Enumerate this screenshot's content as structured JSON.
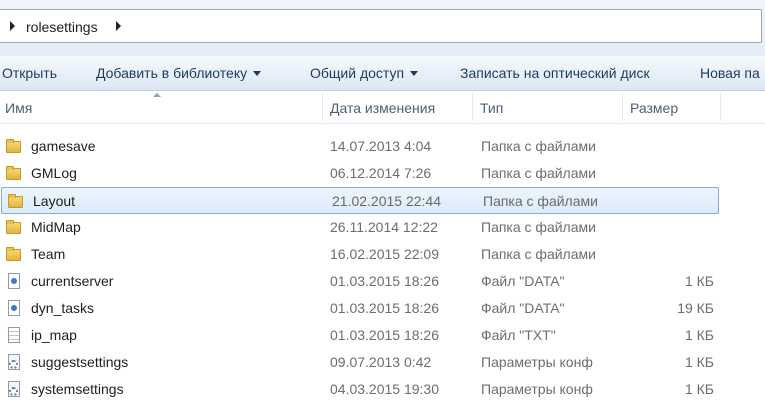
{
  "address": {
    "crumb": "rolesettings"
  },
  "toolbar": {
    "open": "Открыть",
    "add_to_library": "Добавить в библиотеку",
    "share": "Общий доступ",
    "burn": "Записать на оптический диск",
    "new_folder": "Новая па"
  },
  "columns": {
    "name": "Имя",
    "date": "Дата изменения",
    "type": "Тип",
    "size": "Размер"
  },
  "files": [
    {
      "name": "gamesave",
      "date": "14.07.2013 4:04",
      "type": "Папка с файлами",
      "size": "",
      "icon": "folder-icon",
      "selected": false
    },
    {
      "name": "GMLog",
      "date": "06.12.2014 7:26",
      "type": "Папка с файлами",
      "size": "",
      "icon": "folder-icon",
      "selected": false
    },
    {
      "name": "Layout",
      "date": "21.02.2015 22:44",
      "type": "Папка с файлами",
      "size": "",
      "icon": "folder-icon",
      "selected": true
    },
    {
      "name": "MidMap",
      "date": "26.11.2014 12:22",
      "type": "Папка с файлами",
      "size": "",
      "icon": "folder-icon",
      "selected": false
    },
    {
      "name": "Team",
      "date": "16.02.2015 22:09",
      "type": "Папка с файлами",
      "size": "",
      "icon": "folder-icon",
      "selected": false
    },
    {
      "name": "currentserver",
      "date": "01.03.2015 18:26",
      "type": "Файл \"DATA\"",
      "size": "1 КБ",
      "icon": "file-icon",
      "selected": false
    },
    {
      "name": "dyn_tasks",
      "date": "01.03.2015 18:26",
      "type": "Файл \"DATA\"",
      "size": "19 КБ",
      "icon": "file-icon",
      "selected": false
    },
    {
      "name": "ip_map",
      "date": "01.03.2015 18:26",
      "type": "Файл \"TXT\"",
      "size": "1 КБ",
      "icon": "txt-icon",
      "selected": false
    },
    {
      "name": "suggestsettings",
      "date": "09.07.2013 0:42",
      "type": "Параметры конф",
      "size": "1 КБ",
      "icon": "gear-icon",
      "selected": false
    },
    {
      "name": "systemsettings",
      "date": "04.03.2015 19:30",
      "type": "Параметры конф",
      "size": "1 КБ",
      "icon": "gear-icon",
      "selected": false
    }
  ]
}
